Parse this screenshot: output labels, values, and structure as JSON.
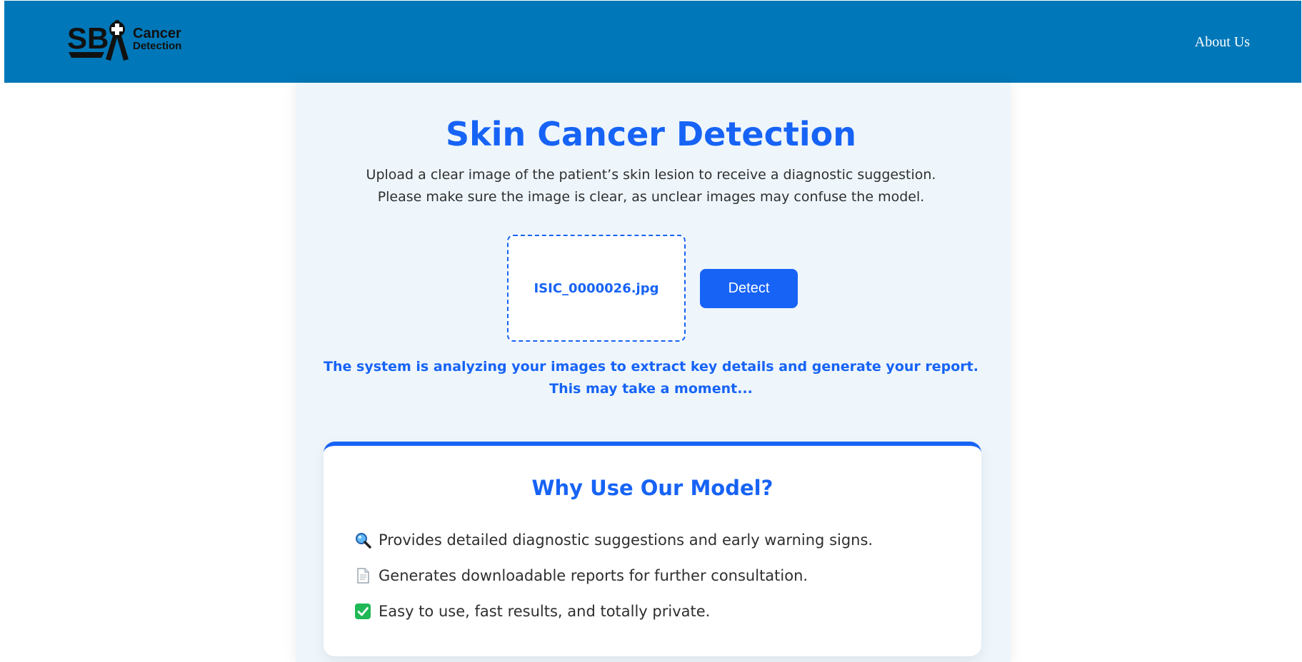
{
  "header": {
    "logo": {
      "mark": "SB",
      "word_top": "Cancer",
      "word_bottom": "Detection"
    },
    "nav": {
      "about_label": "About Us"
    }
  },
  "main": {
    "title": "Skin Cancer Detection",
    "intro": [
      "Upload a clear image of the patient’s skin lesion to receive a diagnostic suggestion.",
      "Please make sure the image is clear, as unclear images may confuse the model."
    ],
    "upload": {
      "file_name": "ISIC_0000026.jpg"
    },
    "detect_label": "Detect",
    "status": [
      "The system is analyzing your images to extract key details and generate your report.",
      "This may take a moment..."
    ]
  },
  "why": {
    "title": "Why Use Our Model?",
    "items": [
      {
        "icon": "magnifier-icon",
        "text": "Provides detailed diagnostic suggestions and early warning signs."
      },
      {
        "icon": "document-icon",
        "text": "Generates downloadable reports for further consultation."
      },
      {
        "icon": "checkmark-icon",
        "text": "Easy to use, fast results, and totally private."
      }
    ]
  },
  "colors": {
    "header_bg": "#0077b8",
    "accent": "#1763f5",
    "panel_bg": "#eef6fc"
  }
}
